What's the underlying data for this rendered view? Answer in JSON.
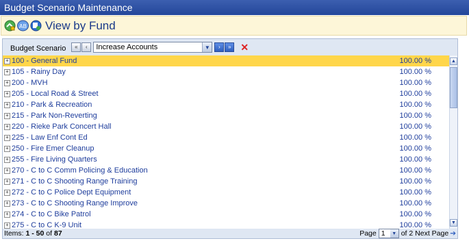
{
  "window": {
    "title": "Budget Scenario Maintenance"
  },
  "toolbar": {
    "view_label": "View by Fund"
  },
  "scenario": {
    "label": "Budget Scenario",
    "selected": "Increase Accounts",
    "nav_first": "«",
    "nav_prev": "‹",
    "nav_next": "›",
    "nav_last": "»"
  },
  "rows": [
    {
      "name": "100 - General Fund",
      "value": "100.00 %",
      "selected": true
    },
    {
      "name": "105 - Rainy Day",
      "value": "100.00 %"
    },
    {
      "name": "200 - MVH",
      "value": "100.00 %"
    },
    {
      "name": "205 - Local Road & Street",
      "value": "100.00 %"
    },
    {
      "name": "210 - Park & Recreation",
      "value": "100.00 %"
    },
    {
      "name": "215 - Park Non-Reverting",
      "value": "100.00 %"
    },
    {
      "name": "220 - Rieke Park Concert Hall",
      "value": "100.00 %"
    },
    {
      "name": "225 - Law Enf Cont Ed",
      "value": "100.00 %"
    },
    {
      "name": "250 - Fire Emer Cleanup",
      "value": "100.00 %"
    },
    {
      "name": "255 - Fire Living Quarters",
      "value": "100.00 %"
    },
    {
      "name": "270 - C to C Comm Policing & Education",
      "value": "100.00 %"
    },
    {
      "name": "271 - C to C Shooting Range Training",
      "value": "100.00 %"
    },
    {
      "name": "272 - C to C Police Dept Equipment",
      "value": "100.00 %"
    },
    {
      "name": "273 - C to C Shooting Range Improve",
      "value": "100.00 %"
    },
    {
      "name": "274 - C to C Bike Patrol",
      "value": "100.00 %"
    },
    {
      "name": "275 - C to C K-9 Unit",
      "value": "100.00 %"
    }
  ],
  "footer": {
    "items_label": "Items:",
    "range": "1 - 50",
    "of_label": "of",
    "total": "87",
    "page_label": "Page",
    "page_value": "1",
    "of_pages": "of 2",
    "next_label": "Next Page"
  },
  "icons": {
    "toolbar": [
      "edit-scenario-icon",
      "spellcheck-icon",
      "view-fund-icon"
    ],
    "delete": "delete-icon"
  },
  "colors": {
    "title_bg": "#23469a",
    "toolbar_bg": "#fdf6d8",
    "selected_row": "#ffd64a",
    "row_text": "#1e3d9c",
    "panel_bg": "#dfe7f3"
  }
}
